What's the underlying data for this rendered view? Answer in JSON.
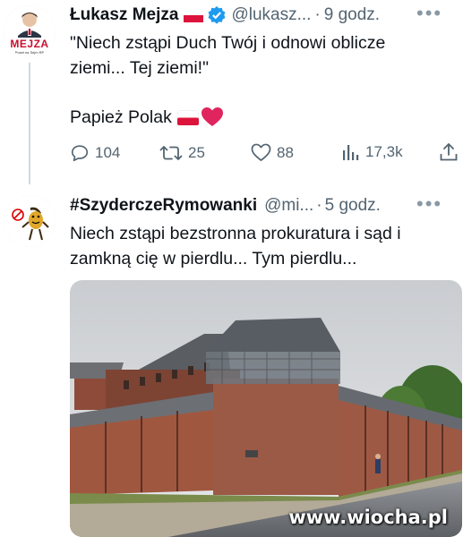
{
  "tweet1": {
    "avatar_text": "MEJZA",
    "avatar_subtext": "Poseł na Sejm RP",
    "display_name": "Łukasz Mejza",
    "handle": "@lukasz...",
    "separator": "·",
    "time": "9 godz.",
    "text_line1": "\"Niech zstąpi Duch Twój i odnowi oblicze",
    "text_line2": "ziemi... Tej ziemi!\"",
    "text_line3": "Papież Polak",
    "replies": "104",
    "retweets": "25",
    "likes": "88",
    "views": "17,3k"
  },
  "tweet2": {
    "display_name": "#SzyderczeRymowanki",
    "handle": "@mi...",
    "separator": "·",
    "time": "5 godz.",
    "text_line1": "Niech zstąpi bezstronna prokuratura i sąd i",
    "text_line2": "zamkną cię w pierdlu... Tym pierdlu..."
  },
  "watermark": "www.wiocha.pl",
  "colors": {
    "text": "#0f1419",
    "secondary": "#536471",
    "verified": "#1d9bf0",
    "heart": "#e0245e"
  }
}
